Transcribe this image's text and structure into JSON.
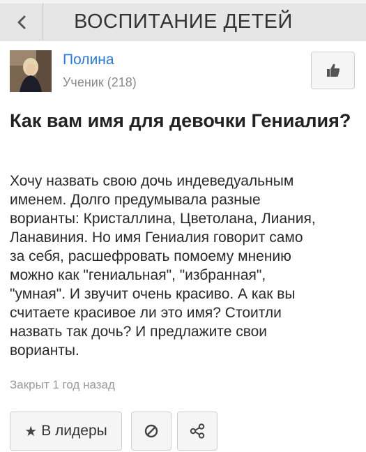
{
  "header": {
    "title": "ВОСПИТАНИЕ ДЕТЕЙ",
    "back_icon": "chevron-left-icon"
  },
  "author": {
    "name": "Полина",
    "rank": "Ученик (218)"
  },
  "question": {
    "title": "Как вам имя для девочки Гениалия?",
    "body": "Хочу назвать свою дочь индеведуальным\nименем. Долго предумывала разные\nворианты: Кристаллина, Цветолана, Лиания,\nЛанавиния. Но имя Гениалия говорит само\nза себя, расшефровать помоему мнению\nможно как \"гениальная\", \"избранная\",\n\"умная\". И звучит очень красиво. А как вы\nсчитаете красивое ли это имя? Стоитли\nназвать так дочь? И предлажите свои\nворианты.",
    "status": "Закрыт 1 год назад"
  },
  "actions": {
    "leaders_label": "В лидеры",
    "leaders_icon": "star-icon",
    "block_icon": "block-icon",
    "share_icon": "share-icon",
    "like_icon": "thumbs-up-icon"
  },
  "colors": {
    "header_bg": "#e6e6e6",
    "author_link": "#2a7bd0",
    "muted": "#8a8a8a"
  }
}
